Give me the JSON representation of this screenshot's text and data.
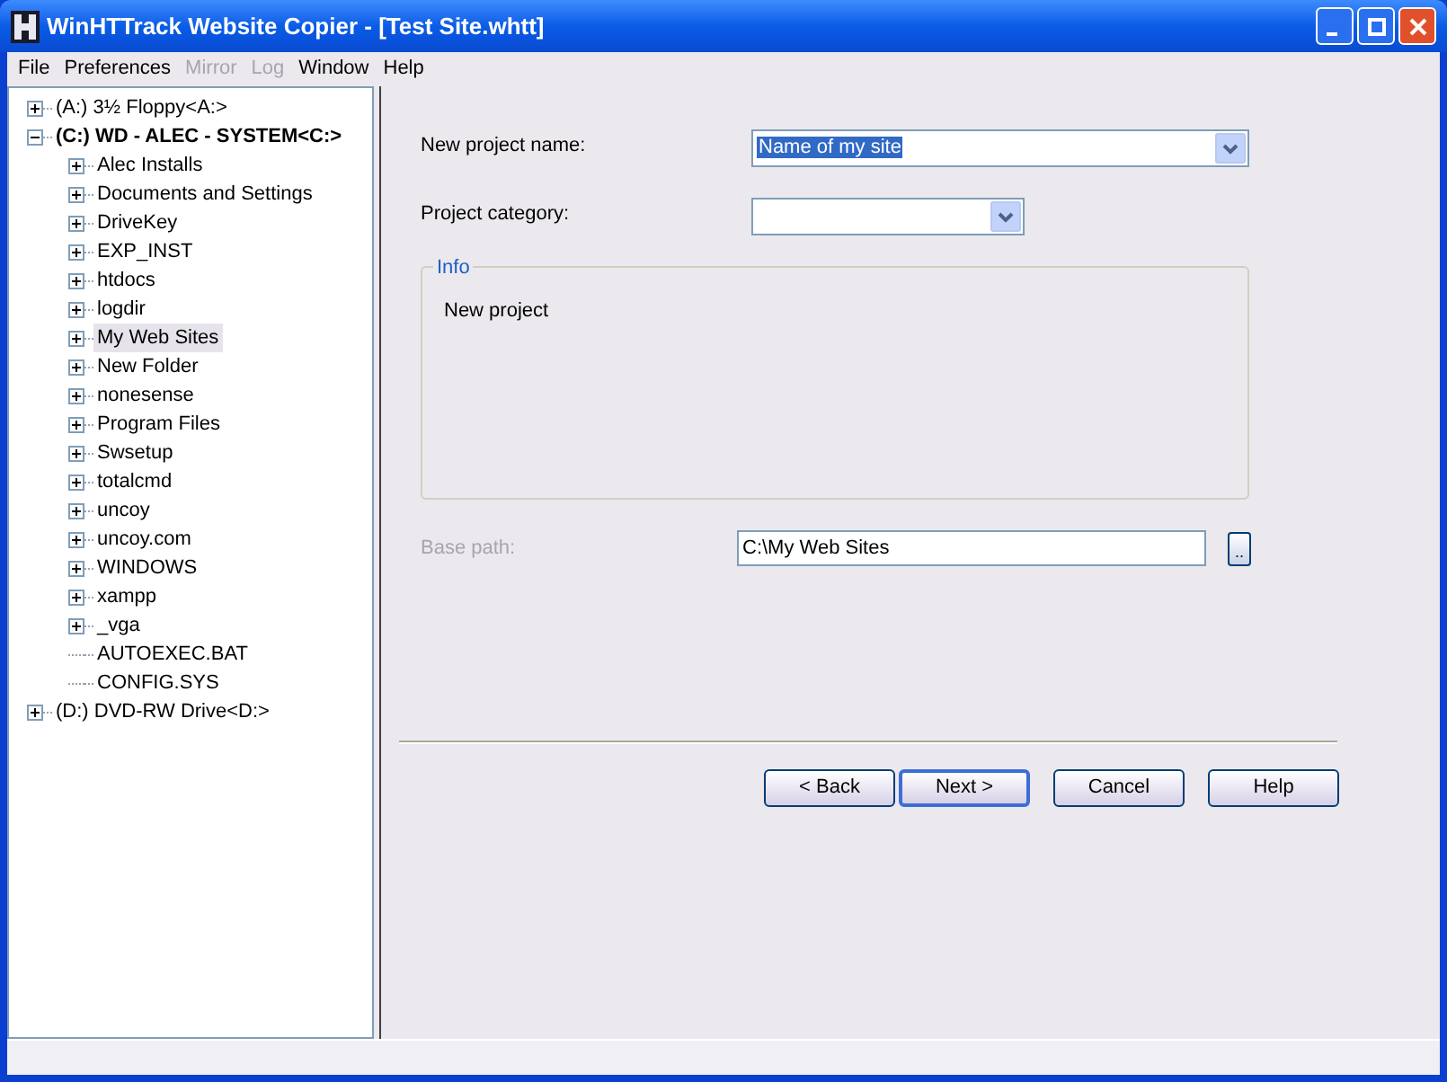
{
  "window": {
    "title": "WinHTTrack Website Copier - [Test Site.whtt]"
  },
  "menu": [
    {
      "label": "File",
      "disabled": false
    },
    {
      "label": "Preferences",
      "disabled": false
    },
    {
      "label": "Mirror",
      "disabled": true
    },
    {
      "label": "Log",
      "disabled": true
    },
    {
      "label": "Window",
      "disabled": false
    },
    {
      "label": "Help",
      "disabled": false
    }
  ],
  "tree": [
    {
      "label": "(A:) 3½ Floppy<A:>",
      "kind": "folder",
      "expanded": false,
      "active": false,
      "selected": false
    },
    {
      "label": "(C:) WD - ALEC - SYSTEM<C:>",
      "kind": "folder",
      "expanded": true,
      "active": true,
      "selected": false,
      "children": [
        {
          "label": "Alec Installs",
          "kind": "folder",
          "expanded": false,
          "active": false,
          "selected": false
        },
        {
          "label": "Documents and Settings",
          "kind": "folder",
          "expanded": false,
          "active": false,
          "selected": false
        },
        {
          "label": "DriveKey",
          "kind": "folder",
          "expanded": false,
          "active": false,
          "selected": false
        },
        {
          "label": "EXP_INST",
          "kind": "folder",
          "expanded": false,
          "active": false,
          "selected": false
        },
        {
          "label": "htdocs",
          "kind": "folder",
          "expanded": false,
          "active": false,
          "selected": false
        },
        {
          "label": "logdir",
          "kind": "folder",
          "expanded": false,
          "active": false,
          "selected": false
        },
        {
          "label": "My Web Sites",
          "kind": "folder",
          "expanded": false,
          "active": false,
          "selected": true
        },
        {
          "label": "New Folder",
          "kind": "folder",
          "expanded": false,
          "active": false,
          "selected": false
        },
        {
          "label": "nonesense",
          "kind": "folder",
          "expanded": false,
          "active": false,
          "selected": false
        },
        {
          "label": "Program Files",
          "kind": "folder",
          "expanded": false,
          "active": false,
          "selected": false
        },
        {
          "label": "Swsetup",
          "kind": "folder",
          "expanded": false,
          "active": false,
          "selected": false
        },
        {
          "label": "totalcmd",
          "kind": "folder",
          "expanded": false,
          "active": false,
          "selected": false
        },
        {
          "label": "uncoy",
          "kind": "folder",
          "expanded": false,
          "active": false,
          "selected": false
        },
        {
          "label": "uncoy.com",
          "kind": "folder",
          "expanded": false,
          "active": false,
          "selected": false
        },
        {
          "label": "WINDOWS",
          "kind": "folder",
          "expanded": false,
          "active": false,
          "selected": false
        },
        {
          "label": "xampp",
          "kind": "folder",
          "expanded": false,
          "active": false,
          "selected": false
        },
        {
          "label": "_vga",
          "kind": "folder",
          "expanded": false,
          "active": false,
          "selected": false
        },
        {
          "label": "AUTOEXEC.BAT",
          "kind": "file",
          "active": false,
          "selected": false
        },
        {
          "label": "CONFIG.SYS",
          "kind": "file",
          "active": false,
          "selected": false
        }
      ]
    },
    {
      "label": "(D:) DVD-RW Drive<D:>",
      "kind": "folder",
      "expanded": false,
      "active": false,
      "selected": false
    }
  ],
  "form": {
    "name_label": "New project name:",
    "name_value": "Name of my site",
    "category_label": "Project category:",
    "info_title": "Info",
    "info_text": "New project",
    "base_path_label": "Base path:",
    "base_path_disabled": true,
    "base_path_value": "C:\\My Web Sites",
    "browse": ".."
  },
  "buttons": [
    {
      "label": "< Back",
      "default": false
    },
    {
      "label": "Next >",
      "default": true
    },
    {
      "label": "Cancel",
      "default": false
    },
    {
      "label": "Help",
      "default": false
    }
  ]
}
